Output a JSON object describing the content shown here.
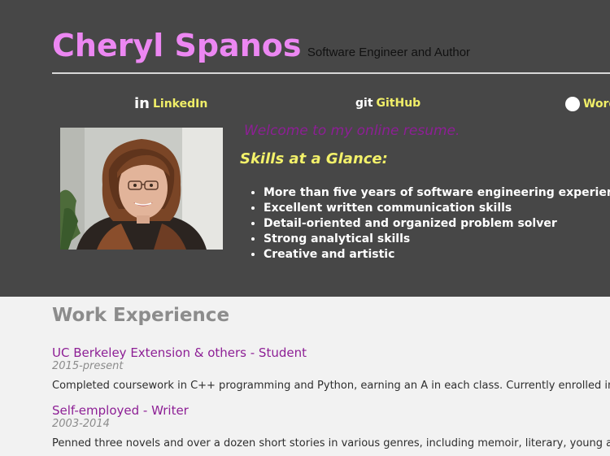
{
  "header": {
    "name": "Cheryl Spanos",
    "tagline": "Software Engineer and Author"
  },
  "social_links": [
    {
      "label": "LinkedIn",
      "icon": "linkedin-icon",
      "glyph": "in"
    },
    {
      "label": "GitHub",
      "icon": "git-icon",
      "glyph": "git"
    },
    {
      "label": "Word",
      "icon": "wordpress-icon",
      "glyph": "W"
    }
  ],
  "intro": {
    "welcome": "Welcome to my online resume.",
    "skills_title": "Skills at a Glance:",
    "skills": [
      "More than five years of software engineering experience in",
      "Excellent written communication skills",
      "Detail-oriented and organized problem solver",
      "Strong analytical skills",
      "Creative and artistic"
    ]
  },
  "work": {
    "title": "Work Experience",
    "jobs": [
      {
        "title": "UC Berkeley Extension & others - Student",
        "dates": "2015-present",
        "description": "Completed coursework in C++ programming and Python, earning an A in each class. Currently enrolled in Udaci"
      },
      {
        "title": "Self-employed - Writer",
        "dates": "2003-2014",
        "description": "Penned three novels and over a dozen short stories in various genres, including memoir, literary, young adult (YA"
      }
    ]
  },
  "colors": {
    "header_bg": "#474747",
    "name": "#ec87f2",
    "accent_purple": "#8d1f95",
    "accent_yellow": "#f0ee68",
    "body_bg": "#f2f2f2"
  }
}
